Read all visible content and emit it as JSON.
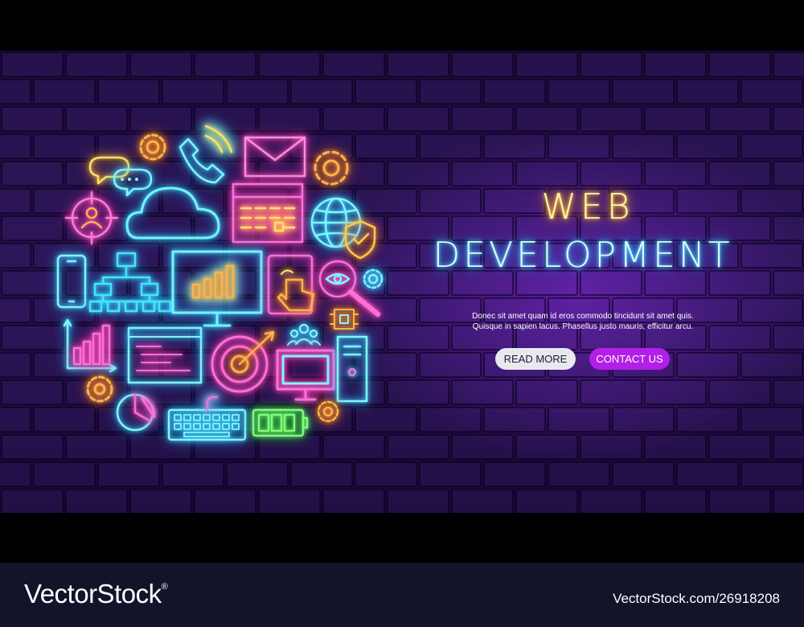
{
  "banner": {
    "title_line1": "WEB",
    "title_line2": "DEVELOPMENT",
    "body_line1": "Donec sit amet quam id eros commodo tincidunt sit amet quis.",
    "body_line2": "Quisque in sapien lacus. Phasellus justo mauris, efficitur arcu.",
    "read_more_label": "READ MORE",
    "contact_us_label": "CONTACT US"
  },
  "icons": [
    "chat-bubbles-icon",
    "target-user-icon",
    "gear-icon",
    "phone-icon",
    "cloud-icon",
    "envelope-icon",
    "calendar-icon",
    "globe-icon",
    "shield-check-icon",
    "smartphone-icon",
    "sitemap-icon",
    "monitor-chart-icon",
    "tablet-touch-icon",
    "magnifier-eye-icon",
    "chip-icon",
    "team-icon",
    "bar-chart-icon",
    "code-window-icon",
    "target-arrow-icon",
    "desktop-icon",
    "computer-tower-icon",
    "pie-chart-icon",
    "keyboard-icon",
    "battery-icon"
  ],
  "colors": {
    "background": "#1f0d45",
    "neon_yellow": "#ffd84a",
    "neon_cyan": "#5ef2ff",
    "neon_pink": "#ff6fd8",
    "neon_green": "#7dff7a",
    "neon_orange": "#ffb04a",
    "contact_button": "#b21fe6",
    "read_more_button": "#e8e8ee",
    "footer": "#12142a"
  },
  "footer": {
    "logo_text": "VectorStock",
    "logo_mark": "®",
    "image_id": "VectorStock.com/26918208"
  }
}
